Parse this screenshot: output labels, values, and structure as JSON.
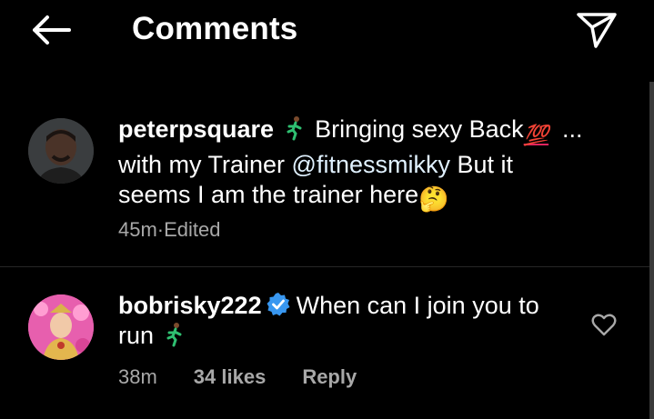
{
  "header": {
    "title": "Comments"
  },
  "caption": {
    "username": "peterpsquare",
    "text_before_emoji": " Bringing sexy Back",
    "hundred_emoji": "💯",
    "line2_before_mention": "with my Trainer ",
    "mention": "@fitnessmikky",
    "line2_after_mention": " But it seems I am the trainer here",
    "thinking_emoji": "🤔",
    "more": "...",
    "time": "45m",
    "separator": " · ",
    "edited": "Edited"
  },
  "reply": {
    "username": "bobrisky222",
    "text": "When can I join you to run",
    "time": "38m",
    "likes": "34 likes",
    "reply_label": "Reply"
  },
  "colors": {
    "background": "#000000",
    "meta_text": "#a8a8a8",
    "verified_blue": "#3897f0",
    "hundred_red": "#e0245e",
    "thinking_yellow": "#ffcc4d"
  }
}
